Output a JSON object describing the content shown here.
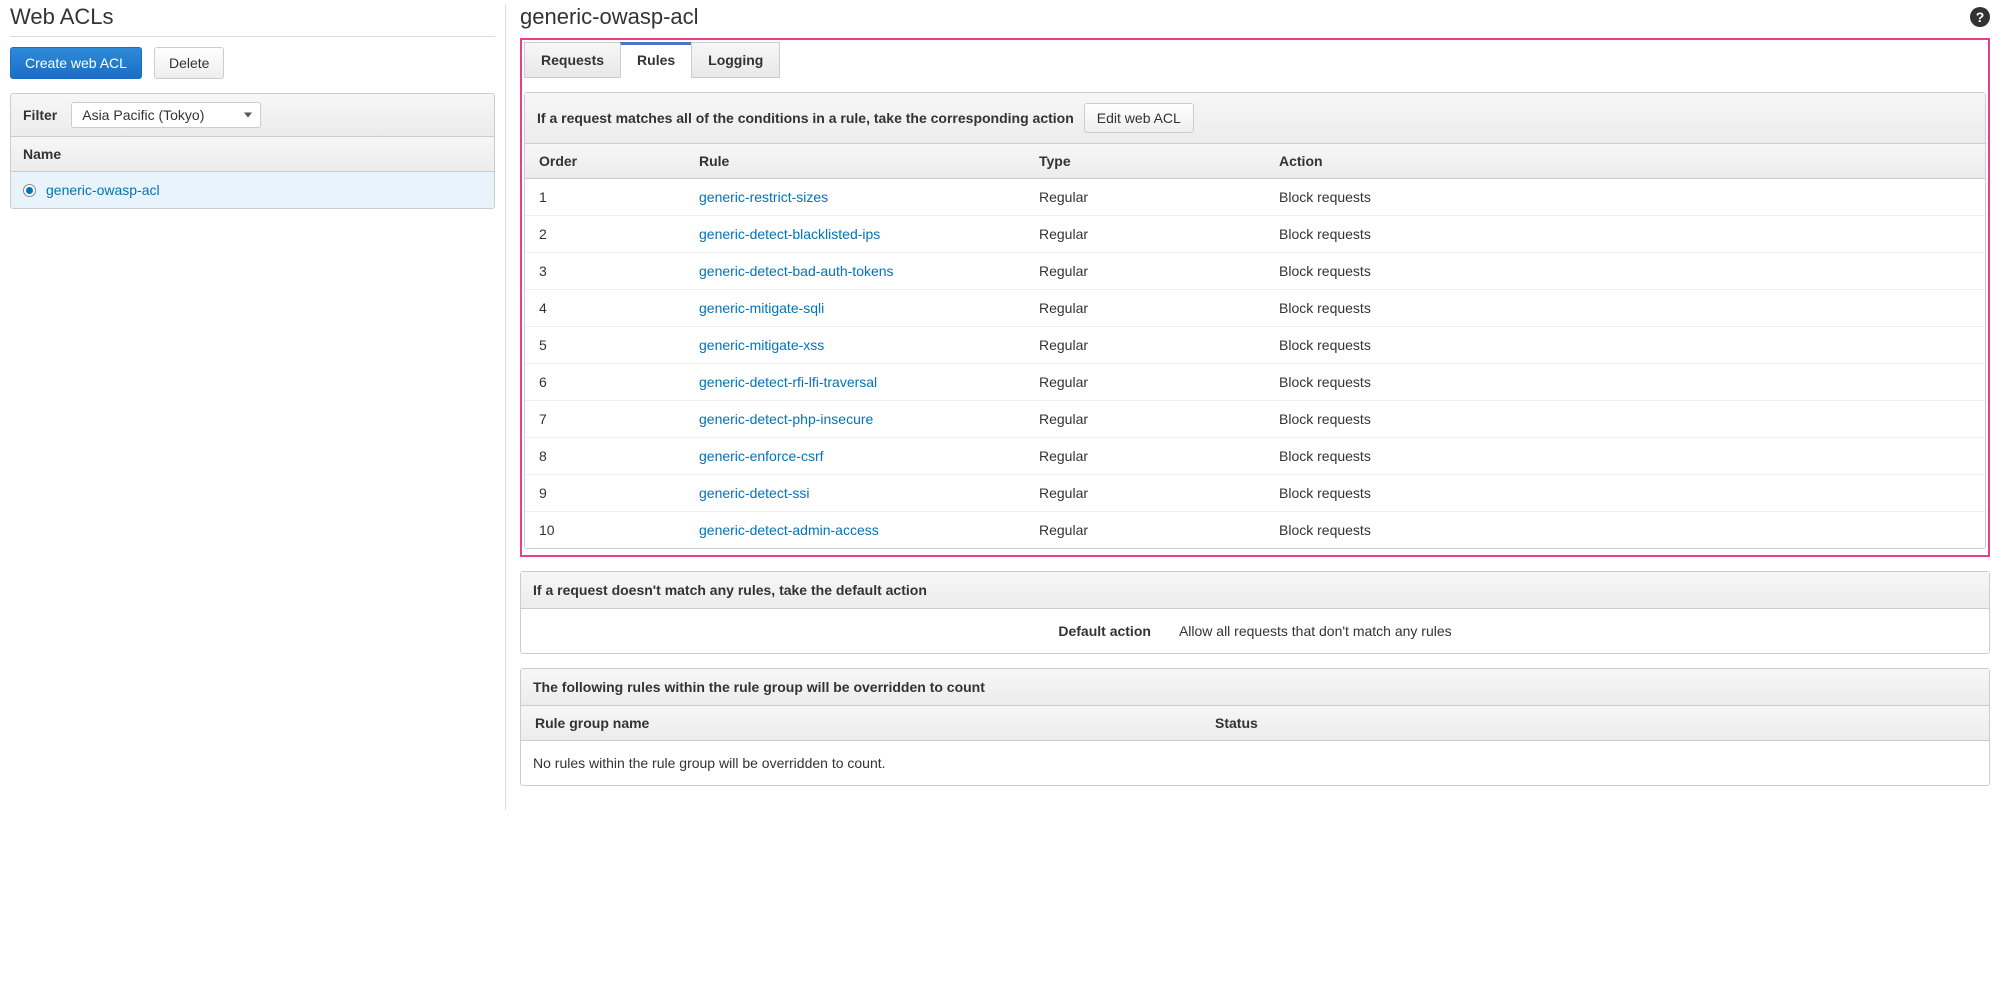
{
  "left": {
    "title": "Web ACLs",
    "create_btn": "Create web ACL",
    "delete_btn": "Delete",
    "filter_label": "Filter",
    "region_value": "Asia Pacific (Tokyo)",
    "name_header": "Name",
    "items": [
      {
        "name": "generic-owasp-acl",
        "selected": true
      }
    ]
  },
  "right": {
    "title": "generic-owasp-acl",
    "tabs": {
      "requests": "Requests",
      "rules": "Rules",
      "logging": "Logging"
    },
    "rules_panel": {
      "header_text": "If a request matches all of the conditions in a rule, take the corresponding action",
      "edit_btn": "Edit web ACL",
      "columns": {
        "order": "Order",
        "rule": "Rule",
        "type": "Type",
        "action": "Action"
      },
      "rows": [
        {
          "order": "1",
          "rule": "generic-restrict-sizes",
          "type": "Regular",
          "action": "Block requests"
        },
        {
          "order": "2",
          "rule": "generic-detect-blacklisted-ips",
          "type": "Regular",
          "action": "Block requests"
        },
        {
          "order": "3",
          "rule": "generic-detect-bad-auth-tokens",
          "type": "Regular",
          "action": "Block requests"
        },
        {
          "order": "4",
          "rule": "generic-mitigate-sqli",
          "type": "Regular",
          "action": "Block requests"
        },
        {
          "order": "5",
          "rule": "generic-mitigate-xss",
          "type": "Regular",
          "action": "Block requests"
        },
        {
          "order": "6",
          "rule": "generic-detect-rfi-lfi-traversal",
          "type": "Regular",
          "action": "Block requests"
        },
        {
          "order": "7",
          "rule": "generic-detect-php-insecure",
          "type": "Regular",
          "action": "Block requests"
        },
        {
          "order": "8",
          "rule": "generic-enforce-csrf",
          "type": "Regular",
          "action": "Block requests"
        },
        {
          "order": "9",
          "rule": "generic-detect-ssi",
          "type": "Regular",
          "action": "Block requests"
        },
        {
          "order": "10",
          "rule": "generic-detect-admin-access",
          "type": "Regular",
          "action": "Block requests"
        }
      ]
    },
    "default_panel": {
      "header_text": "If a request doesn't match any rules, take the default action",
      "label": "Default action",
      "value": "Allow all requests that don't match any rules"
    },
    "override_panel": {
      "header_text": "The following rules within the rule group will be overridden to count",
      "columns": {
        "name": "Rule group name",
        "status": "Status"
      },
      "empty_text": "No rules within the rule group will be overridden to count."
    }
  }
}
